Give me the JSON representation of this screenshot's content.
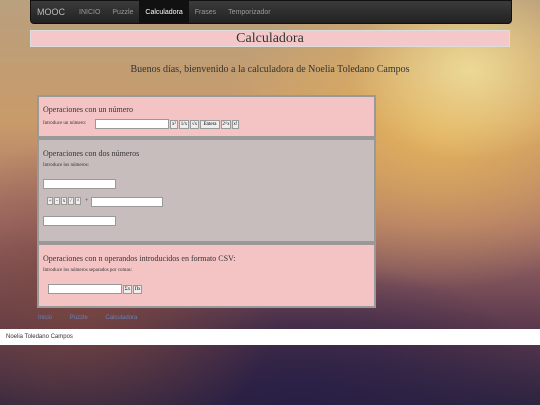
{
  "nav": {
    "brand": "MOOC",
    "items": [
      "INICIO",
      "Puzzle",
      "Calculadora",
      "Frases",
      "Temporizador"
    ]
  },
  "page_title": "Calculadora",
  "greeting": "Buenos días, bienvenido a la calculadora de Noelia Toledano Campos",
  "panel1": {
    "title": "Operaciones con un número",
    "label": "Introduce un número:",
    "buttons": [
      "x²",
      "1/x",
      "√x",
      "Entera",
      "2^x",
      "x!"
    ]
  },
  "panel2": {
    "title": "Operaciones con dos números",
    "label": "Introduce los números:",
    "buttons": [
      "+",
      "-",
      "x",
      "/",
      "^"
    ],
    "operator": "+"
  },
  "panel3": {
    "title": "Operaciones con n operandos introducidos en formato CSV:",
    "label": "Introduce los números separados por comas:",
    "buttons": [
      "Σx",
      "Πx"
    ]
  },
  "footer_links": [
    "Inicio",
    "Puzzle",
    "Calculadora"
  ],
  "footer_name": "Noelia Toledano Campos"
}
